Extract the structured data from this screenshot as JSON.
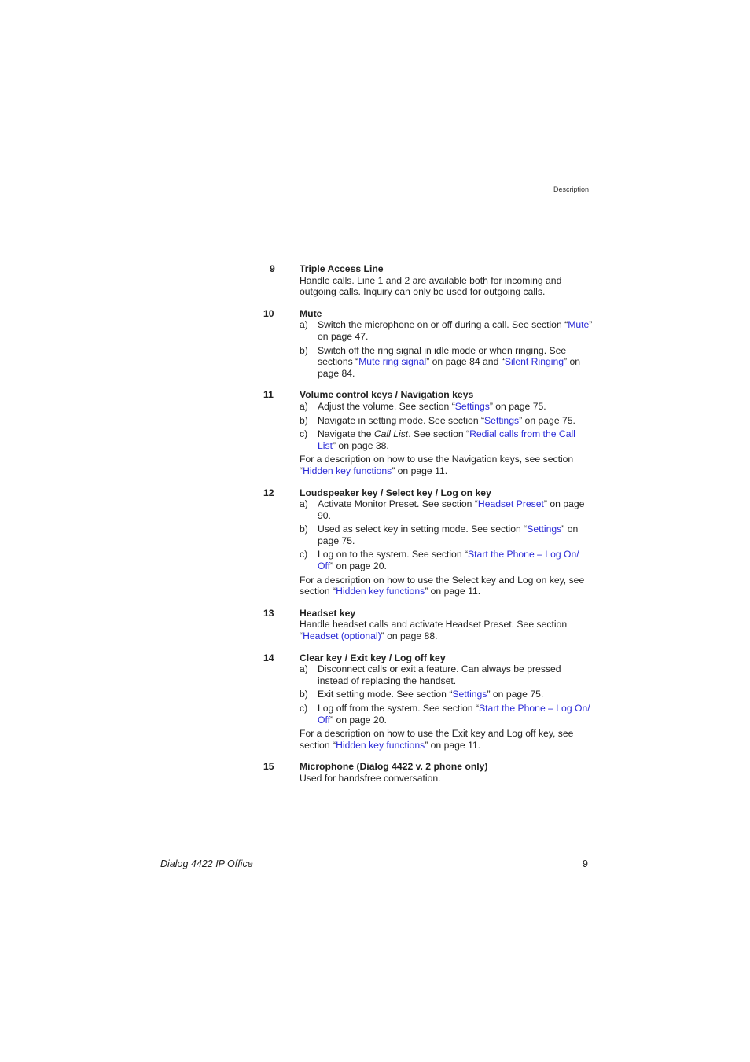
{
  "header": {
    "section": "Description"
  },
  "sections": [
    {
      "number": "9",
      "title": "Triple Access Line",
      "body": "Handle calls. Line 1 and 2 are available both for incoming and outgoing calls. Inquiry can only be used for outgoing calls."
    },
    {
      "number": "10",
      "title": "Mute",
      "items": [
        {
          "label": "a)",
          "pre": "Switch the microphone on or off during a call. See section “",
          "link": "Mute",
          "post": "” on page 47."
        },
        {
          "label": "b)",
          "pre": "Switch off the ring signal in idle mode or when ringing. See sections “",
          "link": "Mute ring signal",
          "mid": "” on page 84 and “",
          "link2": "Silent Ringing",
          "post": "” on page 84."
        }
      ]
    },
    {
      "number": "11",
      "title": "Volume control keys / Navigation keys",
      "items": [
        {
          "label": "a)",
          "pre": "Adjust the volume. See section “",
          "link": "Settings",
          "post": "” on page 75."
        },
        {
          "label": "b)",
          "pre": "Navigate in setting mode. See section “",
          "link": "Settings",
          "post": "” on page 75."
        },
        {
          "label": "c)",
          "pre": "Navigate the ",
          "italic": "Call List",
          "mid": ". See section “",
          "link": "Redial calls from the Call List",
          "post": "” on page 38."
        }
      ],
      "note": {
        "pre": "For a description on how to use the Navigation keys, see section “",
        "link": "Hidden key functions",
        "post": "” on page 11."
      }
    },
    {
      "number": "12",
      "title": "Loudspeaker key / Select key / Log on key",
      "items": [
        {
          "label": "a)",
          "pre": "Activate Monitor Preset. See section “",
          "link": "Headset Preset",
          "post": "” on page 90."
        },
        {
          "label": "b)",
          "pre": "Used as select key in setting mode. See section “",
          "link": "Settings",
          "post": "” on page 75."
        },
        {
          "label": "c)",
          "pre": "Log on to the system. See section “",
          "link": "Start the Phone – Log On/ Off",
          "post": "” on page 20."
        }
      ],
      "note": {
        "pre": "For a description on how to use the Select key and Log on key, see section “",
        "link": "Hidden key functions",
        "post": "” on page 11."
      }
    },
    {
      "number": "13",
      "title": "Headset key",
      "body_pre": "Handle headset calls and activate Headset Preset. See section “",
      "body_link": "Headset (optional)",
      "body_post": "” on page 88."
    },
    {
      "number": "14",
      "title": "Clear key / Exit key / Log off key",
      "items": [
        {
          "label": "a)",
          "pre": "Disconnect calls or exit a feature. Can always be pressed instead of replacing the handset."
        },
        {
          "label": "b)",
          "pre": "Exit setting mode. See section “",
          "link": "Settings",
          "post": "” on page 75."
        },
        {
          "label": "c)",
          "pre": "Log off from the system. See section “",
          "link": "Start the Phone – Log On/ Off",
          "post": "” on page 20."
        }
      ],
      "note": {
        "pre": "For a description on how to use the Exit key and Log off key, see section “",
        "link": "Hidden key functions",
        "post": "” on page 11."
      }
    },
    {
      "number": "15",
      "title": "Microphone (Dialog 4422 v. 2 phone only)",
      "body": "Used for handsfree conversation."
    }
  ],
  "footer": {
    "title": "Dialog 4422 IP Office",
    "page": "9"
  },
  "colors": {
    "link": "#2b2bd6",
    "text": "#222222"
  }
}
